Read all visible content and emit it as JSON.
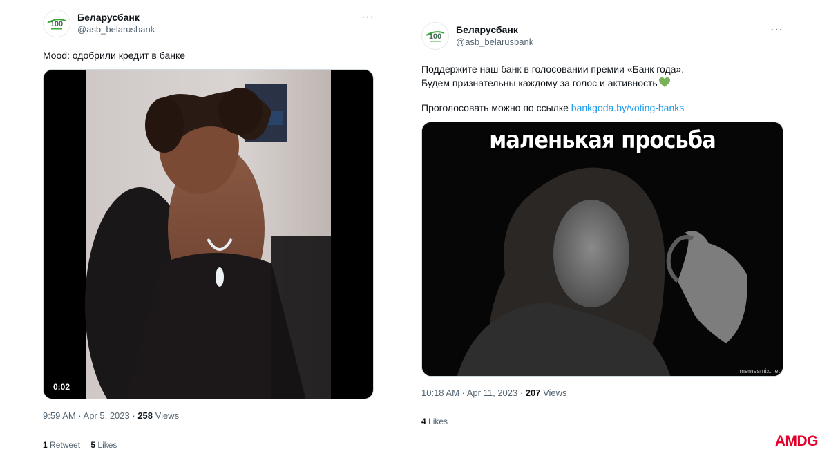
{
  "tweets": [
    {
      "display_name": "Беларусбанк",
      "handle": "@asb_belarusbank",
      "more_glyph": "···",
      "text": "Mood: одобрили кредит в банке",
      "video_timestamp": "0:02",
      "time": "9:59 AM · Apr 5, 2023 · ",
      "views_count": "258",
      "views_label": " Views",
      "retweets_count": "1",
      "retweets_label": " Retweet",
      "likes_count": "5",
      "likes_label": " Likes"
    },
    {
      "display_name": "Беларусбанк",
      "handle": "@asb_belarusbank",
      "more_glyph": "···",
      "text_line1": "Поддержите наш банк в голосовании премии «Банк года».",
      "text_line2": "Будем признательны каждому за голос и активность",
      "text_prefix": "Проголосовать можно по ссылке ",
      "link": "bankgoda.by/voting-banks",
      "meme_caption": "маленькая просьба",
      "watermark": "memesmix.net",
      "time": "10:18 AM · Apr 11, 2023 · ",
      "views_count": "207",
      "views_label": " Views",
      "likes_count": "4",
      "likes_label": " Likes"
    }
  ],
  "avatar_text": "100",
  "brand": "AMDG",
  "colors": {
    "link": "#1d9bf0",
    "brand": "#e4002b",
    "heart": "#78b159",
    "avatar_green": "#3aaa35"
  },
  "icons": [
    "more-icon",
    "green-heart-icon",
    "avatar-logo-icon"
  ]
}
